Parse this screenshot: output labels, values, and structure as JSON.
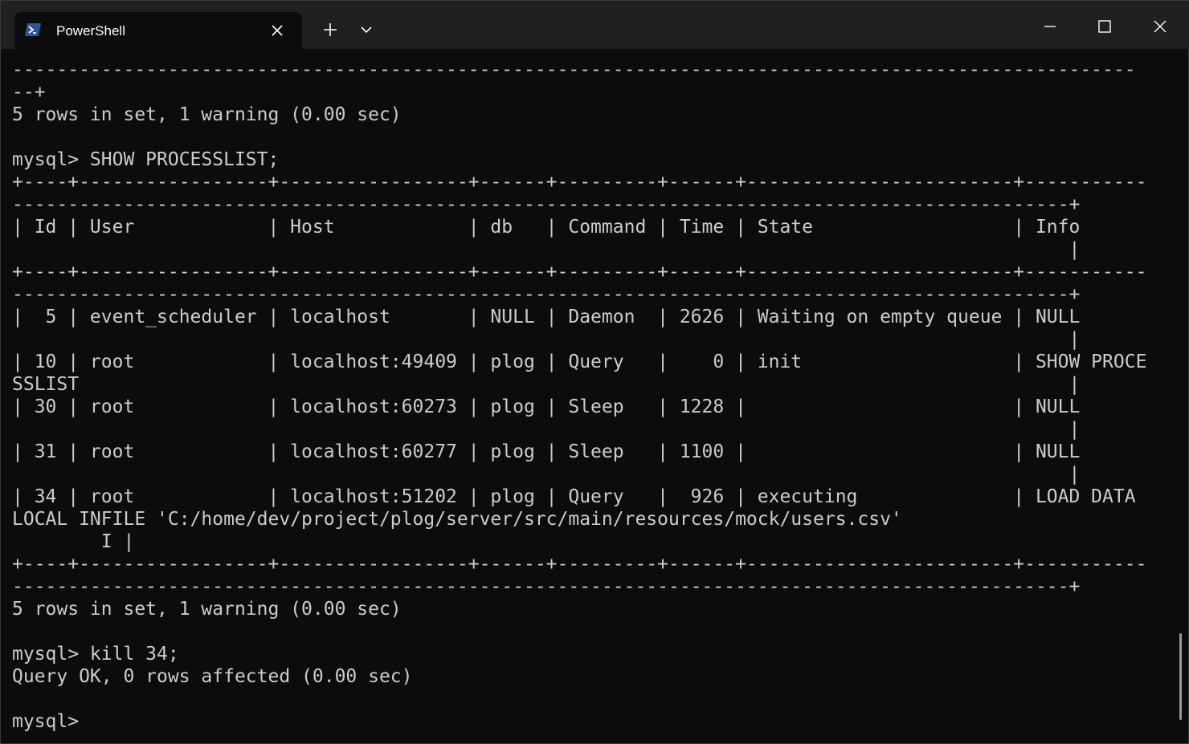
{
  "window": {
    "tab_title": "PowerShell",
    "icons": {
      "tab": "powershell-icon",
      "tab_close": "close-icon",
      "new_tab": "plus-icon",
      "dropdown": "chevron-down-icon",
      "minimize": "minimize-icon",
      "maximize": "maximize-icon",
      "close": "close-icon"
    }
  },
  "terminal": {
    "lines": [
      "-----------------------------------------------------------------------------------------------------",
      "--+",
      "5 rows in set, 1 warning (0.00 sec)",
      "",
      "mysql> SHOW PROCESSLIST;",
      "+----+-----------------+-----------------+------+---------+------+------------------------+-----------",
      "-----------------------------------------------------------------------------------------------+",
      "| Id | User            | Host            | db   | Command | Time | State                  | Info",
      "                                                                                               |",
      "+----+-----------------+-----------------+------+---------+------+------------------------+-----------",
      "-----------------------------------------------------------------------------------------------+",
      "|  5 | event_scheduler | localhost       | NULL | Daemon  | 2626 | Waiting on empty queue | NULL",
      "                                                                                               |",
      "| 10 | root            | localhost:49409 | plog | Query   |    0 | init                   | SHOW PROCE",
      "SSLIST                                                                                         |",
      "| 30 | root            | localhost:60273 | plog | Sleep   | 1228 |                        | NULL",
      "                                                                                               |",
      "| 31 | root            | localhost:60277 | plog | Sleep   | 1100 |                        | NULL",
      "                                                                                               |",
      "| 34 | root            | localhost:51202 | plog | Query   |  926 | executing              | LOAD DATA",
      "LOCAL INFILE 'C:/home/dev/project/plog/server/src/main/resources/mock/users.csv'",
      "        I |",
      "+----+-----------------+-----------------+------+---------+------+------------------------+-----------",
      "-----------------------------------------------------------------------------------------------+",
      "5 rows in set, 1 warning (0.00 sec)",
      "",
      "mysql> kill 34;",
      "Query OK, 0 rows affected (0.00 sec)",
      "",
      "mysql> "
    ]
  }
}
